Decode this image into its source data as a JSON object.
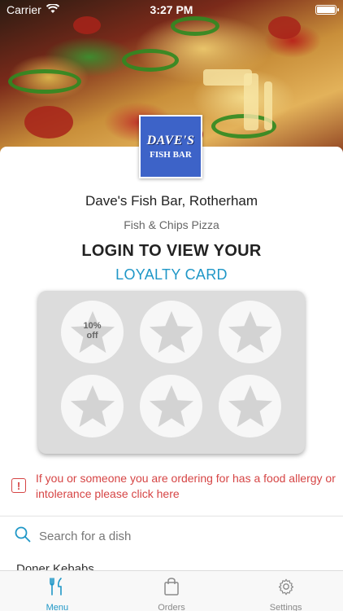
{
  "status_bar": {
    "carrier": "Carrier",
    "time": "3:27 PM"
  },
  "logo": {
    "line1": "DAVE'S",
    "line2": "FISH BAR"
  },
  "shop": {
    "name": "Dave's Fish Bar, Rotherham",
    "categories": "Fish & Chips Pizza"
  },
  "login": {
    "title": "LOGIN TO VIEW YOUR",
    "subtitle": "LOYALTY CARD"
  },
  "loyalty_card": {
    "stamps": [
      {
        "label_line1": "10%",
        "label_line2": "off"
      },
      {
        "label_line1": "",
        "label_line2": ""
      },
      {
        "label_line1": "",
        "label_line2": ""
      },
      {
        "label_line1": "",
        "label_line2": ""
      },
      {
        "label_line1": "",
        "label_line2": ""
      },
      {
        "label_line1": "",
        "label_line2": ""
      }
    ]
  },
  "allergy": {
    "text": "If you or someone you are ordering for has a food allergy or intolerance please click here"
  },
  "search": {
    "placeholder": "Search for a dish"
  },
  "menu_peek": {
    "first_item": "Doner Kebabs"
  },
  "tabs": [
    {
      "label": "Menu",
      "icon": "fork-knife-icon",
      "active": true
    },
    {
      "label": "Orders",
      "icon": "shopping-bag-icon",
      "active": false
    },
    {
      "label": "Settings",
      "icon": "gear-icon",
      "active": false
    }
  ],
  "colors": {
    "accent": "#1f97c7",
    "warning": "#d64545",
    "logo_bg": "#3d63c8",
    "card_bg": "#dcdcdc"
  }
}
